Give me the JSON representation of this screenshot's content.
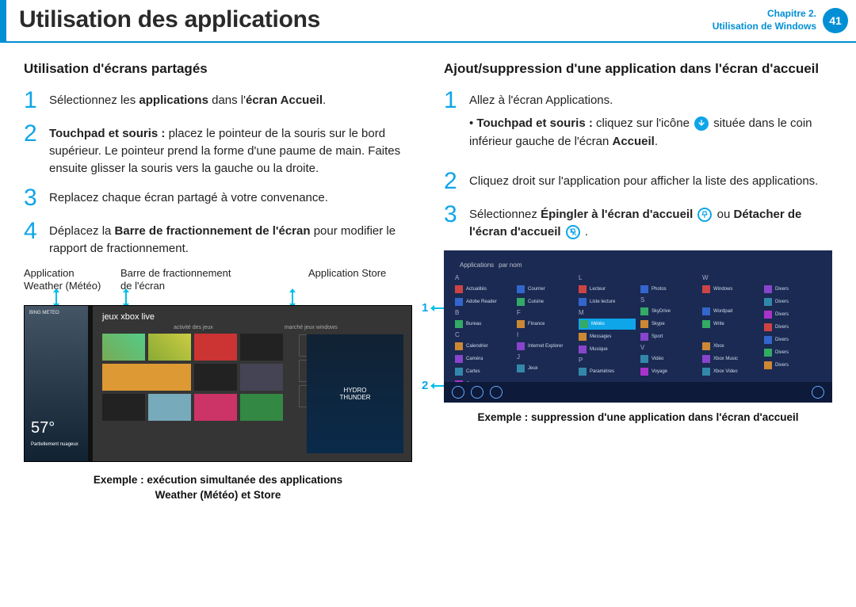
{
  "header": {
    "title": "Utilisation des applications",
    "chapter_line1": "Chapitre 2.",
    "chapter_line2": "Utilisation de Windows",
    "page_number": "41"
  },
  "left": {
    "section_title": "Utilisation d'écrans partagés",
    "step1_pre": "Sélectionnez les ",
    "step1_b1": "applications",
    "step1_mid": " dans l'",
    "step1_b2": "écran Accueil",
    "step1_post": ".",
    "step2_b": "Touchpad et souris : ",
    "step2_text": "placez le pointeur de la souris sur le bord supérieur. Le pointeur prend la forme d'une paume de main. Faites ensuite glisser la souris vers la gauche ou la droite.",
    "step3": "Replacez chaque écran partagé à votre convenance.",
    "step4_pre": "Déplacez la ",
    "step4_b": "Barre de fractionnement de l'écran",
    "step4_post": " pour modifier le rapport de fractionnement.",
    "label_app": "Application Weather (Météo)",
    "label_bar": "Barre de fractionnement de l'écran",
    "label_store": "Application Store",
    "caption_l1": "Exemple : exécution simultanée des applications",
    "caption_l2": "Weather (Météo) et Store",
    "shot": {
      "weather_brand": "BING MÉTÉO",
      "temp": "57°",
      "cond": "Partiellement nuageux",
      "store_header": "jeux xbox live",
      "sub_activity": "activité des jeux",
      "sub_market": "marché jeux windows"
    }
  },
  "right": {
    "section_title": "Ajout/suppression d'une application dans l'écran d'accueil",
    "step1": "Allez à l'écran Applications.",
    "bullet_b": "Touchpad et souris : ",
    "bullet_pre": "cliquez sur l'icône ",
    "bullet_post": " située dans le coin inférieur gauche de l'écran ",
    "bullet_b2": "Accueil",
    "step2": "Cliquez droit sur l'application pour afficher la liste des applications.",
    "step3_pre": "Sélectionnez ",
    "step3_b1": "Épingler à l'écran d'accueil ",
    "step3_mid": " ou ",
    "step3_b2": "Détacher de l'écran d'accueil ",
    "caption": "Exemple : suppression d'une application dans l'écran d'accueil",
    "shot": {
      "title": "Applications",
      "sort": "par nom",
      "callout1": "1",
      "callout2": "2"
    }
  },
  "nums": {
    "n1": "1",
    "n2": "2",
    "n3": "3",
    "n4": "4"
  }
}
